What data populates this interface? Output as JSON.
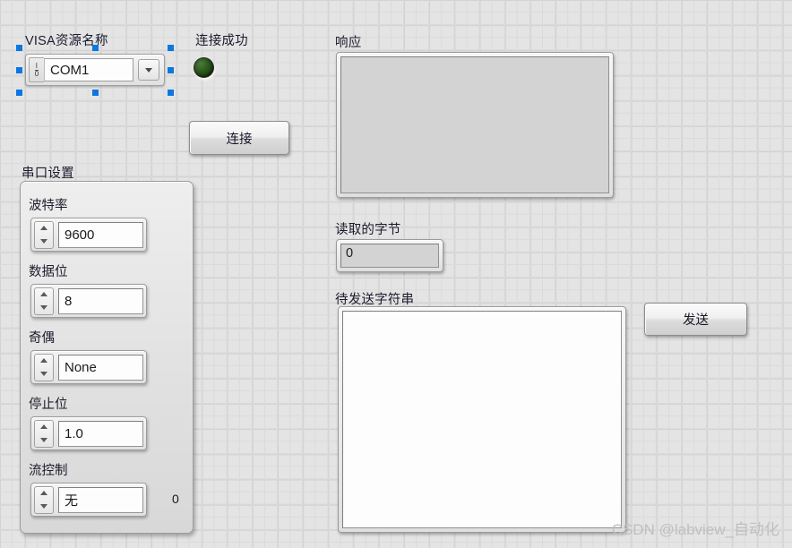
{
  "panel": {
    "background_color": "#e4e4e4",
    "grid_color": "#d2d2d2"
  },
  "visa": {
    "label": "VISA资源名称",
    "value": "COM1",
    "io_icon": "io-terminal-icon",
    "dropdown_icon": "chevron-down-icon",
    "selected": true
  },
  "connection": {
    "status_label": "连接成功",
    "led_name": "connection-led",
    "led_color": "#31601f",
    "button_label": "连接"
  },
  "serial_settings": {
    "title": "串口设置",
    "fields": [
      {
        "label": "波特率",
        "value": "9600"
      },
      {
        "label": "数据位",
        "value": "8"
      },
      {
        "label": "奇偶",
        "value": "None"
      },
      {
        "label": "停止位",
        "value": "1.0"
      },
      {
        "label": "流控制",
        "value": "无"
      }
    ],
    "flow_control_extra": "0"
  },
  "response": {
    "label": "响应",
    "value": ""
  },
  "bytes_read": {
    "label": "读取的字节",
    "value": "0"
  },
  "send_string": {
    "label": "待发送字符串",
    "value": "",
    "button_label": "发送"
  },
  "watermark": {
    "text": "CSDN @labview_自动化",
    "color": "#bfbfbf"
  }
}
